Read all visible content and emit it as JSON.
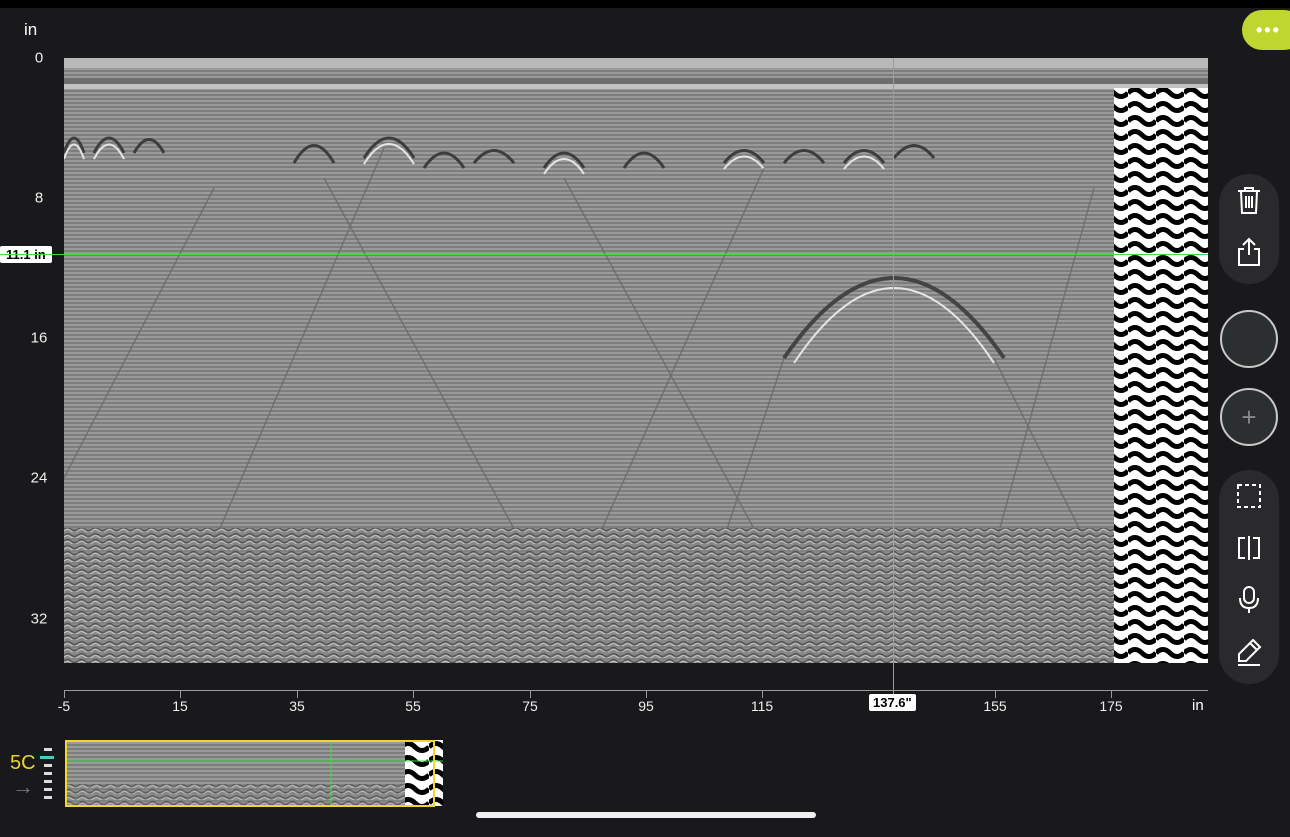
{
  "axis": {
    "y_unit": "in",
    "y_ticks": [
      "0",
      "8",
      "16",
      "24",
      "32"
    ],
    "y_marker": "11.1 in",
    "x_unit": "in",
    "x_ticks": [
      "-5",
      "15",
      "35",
      "55",
      "75",
      "95",
      "115",
      "155",
      "175"
    ],
    "x_marker": "137.6\""
  },
  "toolbar": {
    "menu_label": "•••",
    "add_label": "+"
  },
  "minimap": {
    "label": "5C",
    "arrow": "→"
  },
  "colors": {
    "crosshair": "#3ddc4a",
    "menu_accent": "#bfd630",
    "minimap_frame": "#f0d72a",
    "minimap_active": "#3fd0c0"
  }
}
